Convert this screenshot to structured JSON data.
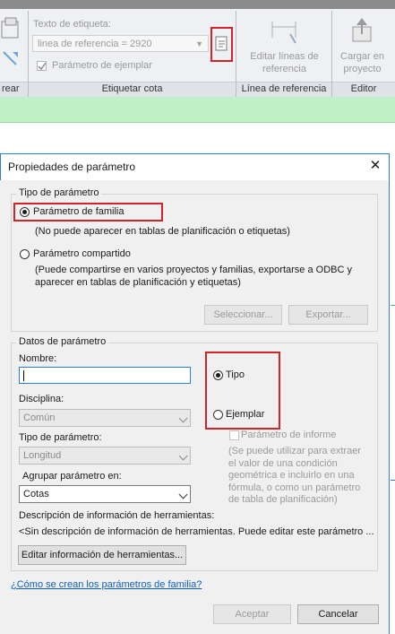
{
  "ribbon": {
    "label_field": "Texto de etiqueta:",
    "label_value": "linea de referencia = 2920",
    "instance_param": "Parámetro de ejemplar",
    "edit_lines": "Editar líneas de referencia",
    "load_project": "Cargar en proyecto",
    "panel_crear": "rear",
    "panel_etiquetar": "Etiquetar cota",
    "panel_linea": "Línea de referencia",
    "panel_editor": "Editor"
  },
  "dialog": {
    "title": "Propiedades de parámetro",
    "param_type_group": "Tipo de parámetro",
    "family_param": "Parámetro de familia",
    "family_param_note": "(No puede aparecer en tablas de planificación o etiquetas)",
    "shared_param": "Parámetro compartido",
    "shared_param_note_1": "(Puede compartirse en varios proyectos y familias, exportarse a ODBC y",
    "shared_param_note_2": "aparecer en tablas de planificación y etiquetas)",
    "select_btn": "Seleccionar...",
    "export_btn": "Exportar...",
    "data_group": "Datos de parámetro",
    "name_label": "Nombre:",
    "name_value": "",
    "discipline_label": "Disciplina:",
    "discipline_value": "Común",
    "type_label": "Tipo de parámetro:",
    "type_value": "Longitud",
    "group_label": "Agrupar parámetro en:",
    "group_value": "Cotas",
    "type_radio": "Tipo",
    "instance_radio": "Ejemplar",
    "report_param": "Parámetro de informe",
    "report_note_1": "(Se puede utilizar para extraer",
    "report_note_2": "el valor de una condición",
    "report_note_3": "geométrica e incluirlo en una",
    "report_note_4": "fórmula, o como un parámetro",
    "report_note_5": "de tabla de planificación)",
    "tooltip_label": "Descripción de información de herramientas:",
    "tooltip_value": "<Sin descripción de información de herramientas. Puede editar este parámetro ...",
    "edit_tooltip_btn": "Editar información de herramientas...",
    "help_link": "¿Cómo se crean los parámetros de familia?",
    "ok_btn": "Aceptar",
    "cancel_btn": "Cancelar",
    "close_symbol": "✕"
  },
  "colors": {
    "highlight": "#d0232a",
    "link": "#0f5fc2",
    "strip": "#bff0c6"
  }
}
